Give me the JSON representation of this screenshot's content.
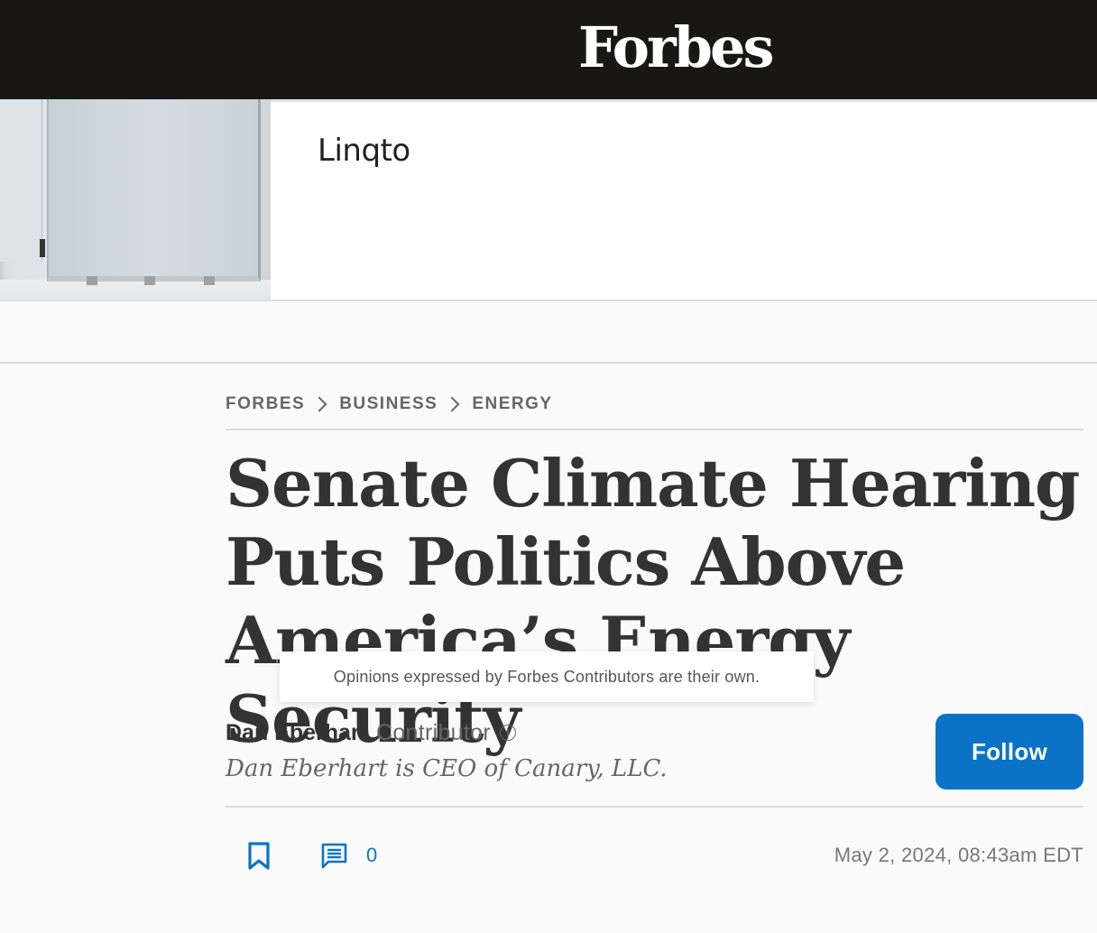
{
  "header": {
    "logo": "Forbes"
  },
  "ad": {
    "brand": "Linqto"
  },
  "breadcrumb": [
    {
      "label": "FORBES"
    },
    {
      "label": "BUSINESS"
    },
    {
      "label": "ENERGY"
    }
  ],
  "article": {
    "headline": "Senate Climate Hearing Puts Politics Above America’s Energy Security",
    "disclaimer": "Opinions expressed by Forbes Contributors are their own.",
    "author": {
      "name": "Dan Eberhart",
      "role": "Contributor",
      "info_glyph": "i",
      "bio": "Dan Eberhart is CEO of Canary, LLC."
    },
    "follow_label": "Follow",
    "comment_count": "0",
    "published": "May 2, 2024, 08:43am EDT"
  },
  "colors": {
    "topbar": "#181716",
    "accent": "#0b73c7",
    "text": "#333333"
  }
}
